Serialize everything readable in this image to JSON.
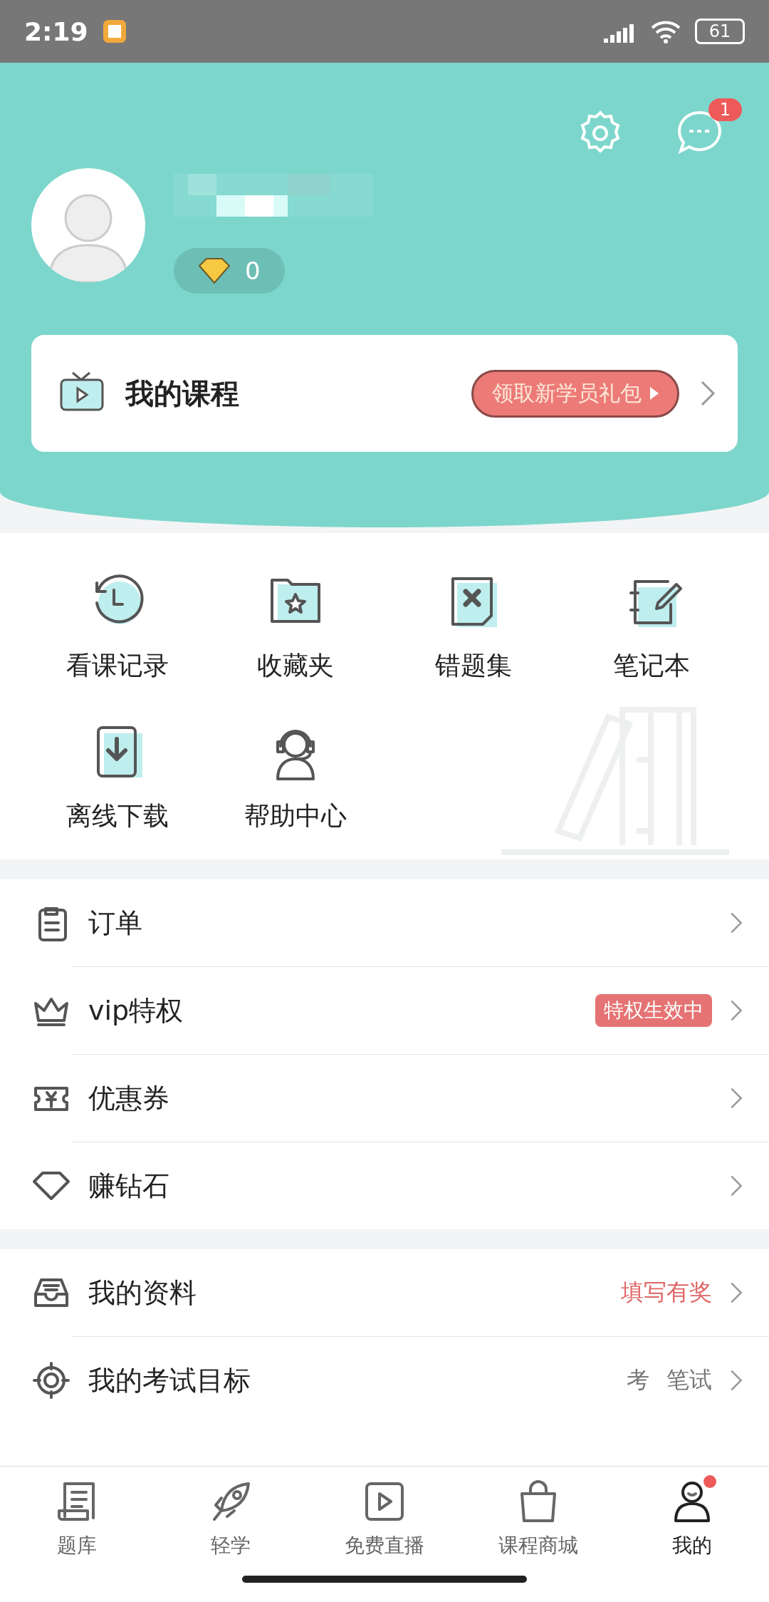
{
  "status_bar": {
    "time": "2:19",
    "battery": "61"
  },
  "header": {
    "message_badge": "1",
    "diamonds": "0"
  },
  "course_card": {
    "title": "我的课程",
    "promo": "领取新学员礼包"
  },
  "shortcuts": [
    {
      "label": "看课记录",
      "kind": "history"
    },
    {
      "label": "收藏夹",
      "kind": "favorites"
    },
    {
      "label": "错题集",
      "kind": "mistakes"
    },
    {
      "label": "笔记本",
      "kind": "notebook"
    },
    {
      "label": "离线下载",
      "kind": "download"
    },
    {
      "label": "帮助中心",
      "kind": "help"
    }
  ],
  "menu_groups": [
    [
      {
        "label": "订单",
        "kind": "order"
      },
      {
        "label": "vip特权",
        "kind": "vip",
        "badge": "特权生效中"
      },
      {
        "label": "优惠券",
        "kind": "coupon"
      },
      {
        "label": "赚钻石",
        "kind": "diamond"
      }
    ],
    [
      {
        "label": "我的资料",
        "kind": "profile",
        "note": "填写有奖"
      },
      {
        "label": "我的考试目标",
        "kind": "target",
        "note_parts": [
          "考",
          "笔试"
        ]
      }
    ]
  ],
  "tabs": [
    {
      "label": "题库",
      "kind": "bank",
      "selected": false,
      "dot": false
    },
    {
      "label": "轻学",
      "kind": "rocket",
      "selected": false,
      "dot": false
    },
    {
      "label": "免费直播",
      "kind": "live",
      "selected": false,
      "dot": false
    },
    {
      "label": "课程商城",
      "kind": "shop",
      "selected": false,
      "dot": false
    },
    {
      "label": "我的",
      "kind": "me",
      "selected": true,
      "dot": true
    }
  ]
}
